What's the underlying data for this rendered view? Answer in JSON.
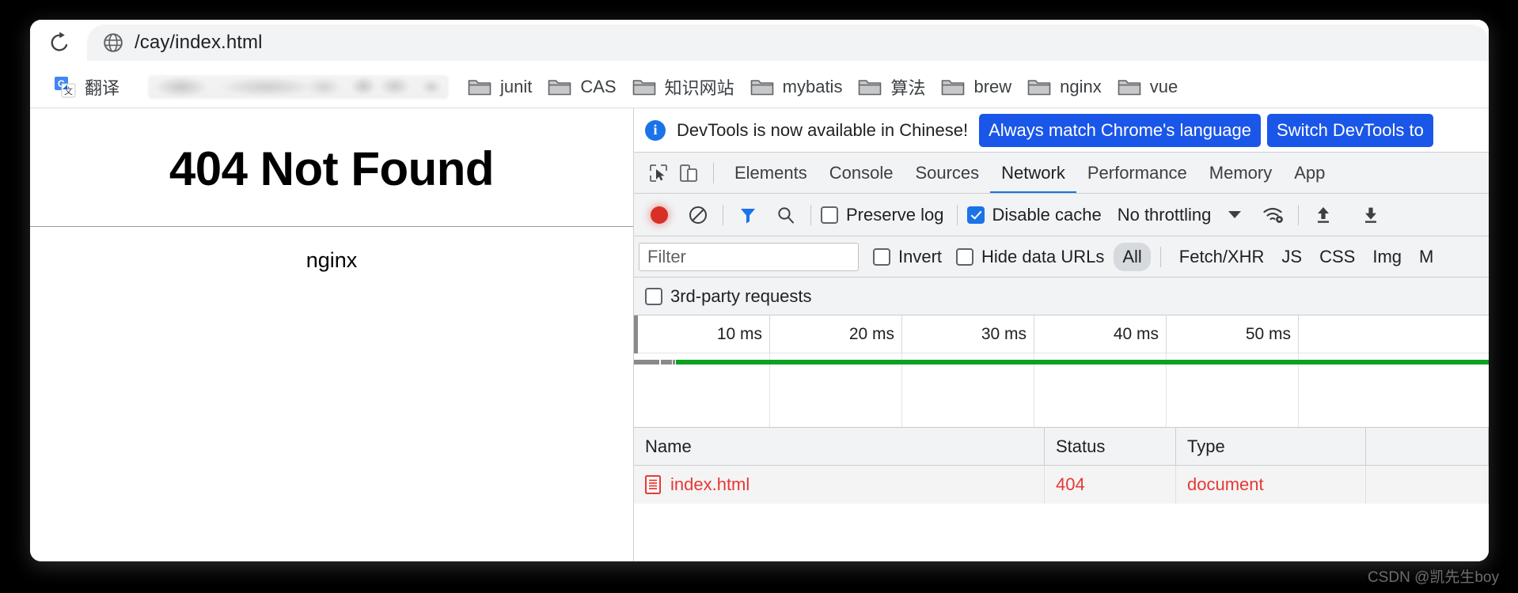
{
  "browser": {
    "reload_icon": "reload-icon",
    "omnibox": {
      "site_icon": "globe-icon",
      "url": "/cay/index.html"
    },
    "bookmarks": [
      {
        "label": "翻译",
        "icon": "google-translate-icon"
      },
      {
        "label": "junit",
        "icon": "folder-icon"
      },
      {
        "label": "CAS",
        "icon": "folder-icon"
      },
      {
        "label": "知识网站",
        "icon": "folder-icon"
      },
      {
        "label": "mybatis",
        "icon": "folder-icon"
      },
      {
        "label": "算法",
        "icon": "folder-icon"
      },
      {
        "label": "brew",
        "icon": "folder-icon"
      },
      {
        "label": "nginx",
        "icon": "folder-icon"
      },
      {
        "label": "vue",
        "icon": "folder-icon"
      }
    ]
  },
  "page": {
    "heading": "404 Not Found",
    "server": "nginx"
  },
  "devtools": {
    "banner": {
      "info_icon": "info-icon",
      "message": "DevTools is now available in Chinese!",
      "primary_button": "Always match Chrome's language",
      "secondary_button": "Switch DevTools to"
    },
    "tabs": [
      {
        "label": "Elements",
        "active": false
      },
      {
        "label": "Console",
        "active": false
      },
      {
        "label": "Sources",
        "active": false
      },
      {
        "label": "Network",
        "active": true
      },
      {
        "label": "Performance",
        "active": false
      },
      {
        "label": "Memory",
        "active": false
      },
      {
        "label": "App",
        "active": false
      }
    ],
    "tab_icons": {
      "inspect": "inspect-cursor-icon",
      "device": "device-toolbar-icon"
    },
    "network_toolbar": {
      "record_icon": "record-icon",
      "clear_icon": "clear-icon",
      "filter_icon": "filter-funnel-icon",
      "search_icon": "search-icon",
      "preserve_log_label": "Preserve log",
      "preserve_log_checked": false,
      "disable_cache_label": "Disable cache",
      "disable_cache_checked": true,
      "throttling_value": "No throttling",
      "network_conditions_icon": "wifi-settings-icon",
      "import_icon": "import-har-icon",
      "export_icon": "export-har-icon"
    },
    "filter_row": {
      "filter_placeholder": "Filter",
      "filter_value": "",
      "invert_label": "Invert",
      "invert_checked": false,
      "hide_data_urls_label": "Hide data URLs",
      "hide_data_urls_checked": false,
      "type_chips": [
        {
          "label": "All",
          "selected": true
        },
        {
          "label": "Fetch/XHR",
          "selected": false
        },
        {
          "label": "JS",
          "selected": false
        },
        {
          "label": "CSS",
          "selected": false
        },
        {
          "label": "Img",
          "selected": false
        },
        {
          "label": "M",
          "selected": false
        }
      ]
    },
    "third_party": {
      "label": "3rd-party requests",
      "checked": false
    },
    "overview": {
      "ticks": [
        "10 ms",
        "20 ms",
        "30 ms",
        "40 ms",
        "50 ms"
      ],
      "bar_color": "#0ca023",
      "idle_color": "#8a8a8a"
    },
    "table": {
      "columns": [
        "Name",
        "Status",
        "Type"
      ],
      "rows": [
        {
          "name": "index.html",
          "status": "404",
          "type": "document",
          "icon": "document-icon",
          "color": "#e53935"
        }
      ]
    }
  },
  "watermark": "CSDN @凯先生boy"
}
